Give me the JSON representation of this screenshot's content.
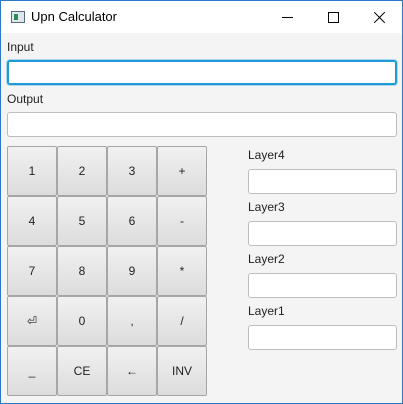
{
  "window": {
    "title": "Upn Calculator"
  },
  "input": {
    "label": "Input",
    "value": ""
  },
  "output": {
    "label": "Output",
    "value": ""
  },
  "keys": [
    [
      "1",
      "2",
      "3",
      "+"
    ],
    [
      "4",
      "5",
      "6",
      "-"
    ],
    [
      "7",
      "8",
      "9",
      "*"
    ],
    [
      "⏎",
      "0",
      ",",
      "/"
    ],
    [
      "_",
      "CE",
      "←",
      "INV"
    ]
  ],
  "layers": [
    {
      "label": "Layer4",
      "value": ""
    },
    {
      "label": "Layer3",
      "value": ""
    },
    {
      "label": "Layer2",
      "value": ""
    },
    {
      "label": "Layer1",
      "value": ""
    }
  ]
}
